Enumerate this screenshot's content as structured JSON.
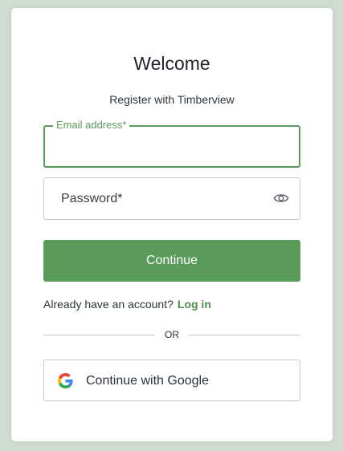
{
  "header": {
    "title": "Welcome",
    "subtitle": "Register with Timberview"
  },
  "form": {
    "email": {
      "label": "Email address*",
      "value": ""
    },
    "password": {
      "placeholder": "Password*",
      "value": "",
      "toggle_icon": "eye-icon"
    },
    "continue_label": "Continue"
  },
  "login": {
    "prompt": "Already have an account?",
    "link_label": "Log in"
  },
  "divider": {
    "label": "OR"
  },
  "social": {
    "google_label": "Continue with Google",
    "google_icon": "google-icon"
  },
  "colors": {
    "accent": "#5a9a5a",
    "link": "#4c8c4c",
    "background": "#cfdccf",
    "card": "#ffffff",
    "border": "#c2c8d0"
  }
}
